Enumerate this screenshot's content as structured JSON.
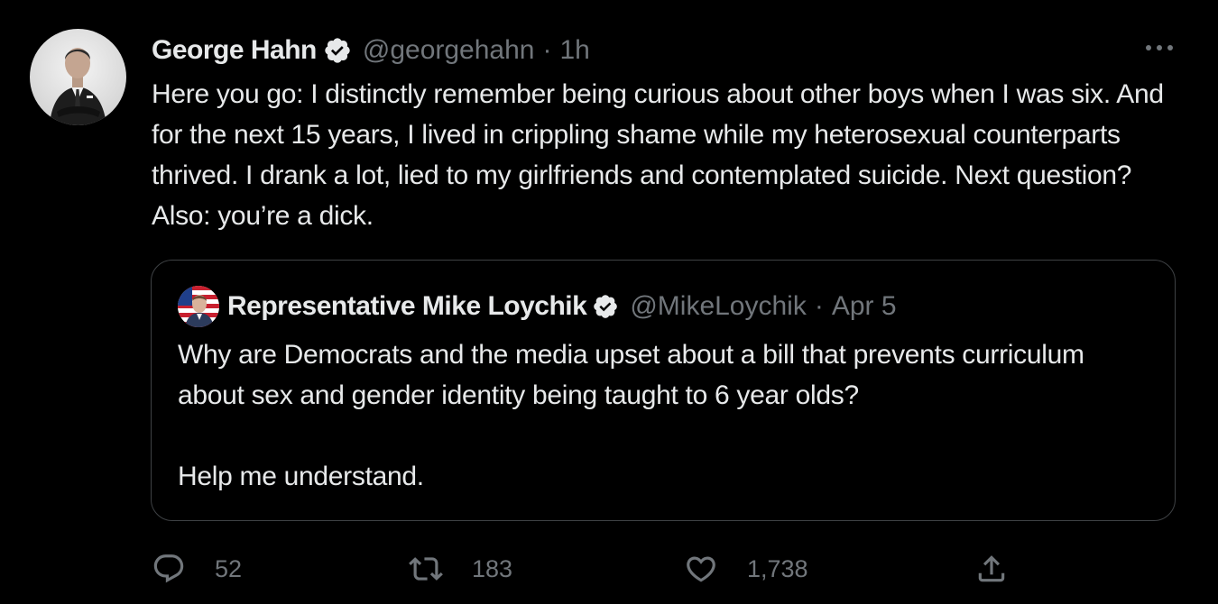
{
  "tweet": {
    "author": {
      "display_name": "George Hahn",
      "handle": "@georgehahn",
      "verified": true
    },
    "separator": "·",
    "time": "1h",
    "text": "Here you go: I distinctly remember being curious about other boys when I was six. And for the next 15 years, I lived in crippling shame while my heterosexual counterparts thrived. I drank a lot, lied to my girlfriends and contemplated suicide. Next question? Also: you’re a dick.",
    "quoted": {
      "author": {
        "display_name": "Representative Mike Loychik",
        "handle": "@MikeLoychik",
        "verified": true
      },
      "separator": "·",
      "time": "Apr 5",
      "text": "Why are Democrats and the media upset about a bill that prevents curriculum about sex and gender identity being taught to 6 year olds?\n\nHelp me understand."
    },
    "actions": {
      "reply_count": "52",
      "retweet_count": "183",
      "like_count": "1,738"
    }
  },
  "icons": {
    "verified": "verified-badge-icon",
    "more": "more-horizontal-icon",
    "reply": "reply-icon",
    "retweet": "retweet-icon",
    "like": "heart-icon",
    "share": "share-icon"
  },
  "colors": {
    "background": "#000000",
    "text_primary": "#e7e9ea",
    "text_secondary": "#71767b",
    "border": "#3e4144"
  }
}
